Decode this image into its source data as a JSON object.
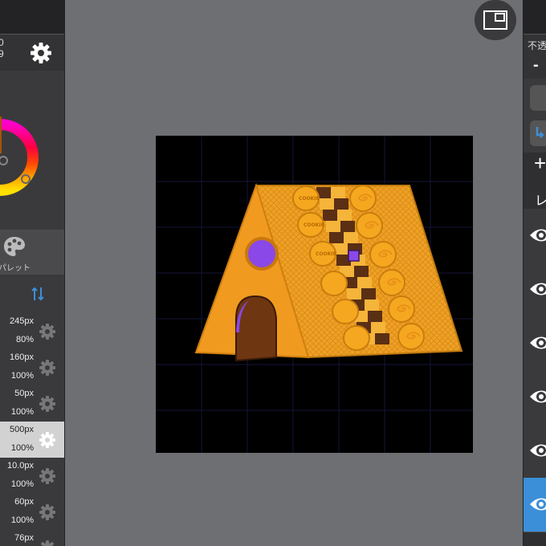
{
  "left_panel": {
    "coord_x": "0",
    "coord_y": "9",
    "palette_label": "パレット",
    "brushes": [
      {
        "size": "245px",
        "opacity": "80%",
        "selected": false
      },
      {
        "size": "160px",
        "opacity": "100%",
        "selected": false
      },
      {
        "size": "50px",
        "opacity": "100%",
        "selected": false
      },
      {
        "size": "500px",
        "opacity": "100%",
        "selected": true
      },
      {
        "size": "10.0px",
        "opacity": "100%",
        "selected": false
      },
      {
        "size": "60px",
        "opacity": "100%",
        "selected": false
      },
      {
        "size": "76px",
        "opacity": "",
        "selected": false
      }
    ]
  },
  "right_panel": {
    "opacity_label": "不透",
    "minus_label": "-",
    "add_label": "+",
    "layer_label": "レ",
    "layers": [
      {
        "visible": true,
        "selected": false
      },
      {
        "visible": true,
        "selected": false
      },
      {
        "visible": true,
        "selected": false
      },
      {
        "visible": true,
        "selected": false
      },
      {
        "visible": true,
        "selected": false
      },
      {
        "visible": true,
        "selected": true
      }
    ]
  },
  "canvas": {
    "cookie_text": "COOKIE"
  },
  "colors": {
    "accent": "#3b8fd9",
    "gingerbread": "#f3a225",
    "chocolate": "#5a2f14",
    "window": "#8a48e8"
  },
  "icons": [
    "settings-gear-icon",
    "color-wheel-icon",
    "palette-icon",
    "swap-arrows-icon",
    "brush-gear-icon",
    "view-toggle-icon",
    "eye-icon"
  ]
}
